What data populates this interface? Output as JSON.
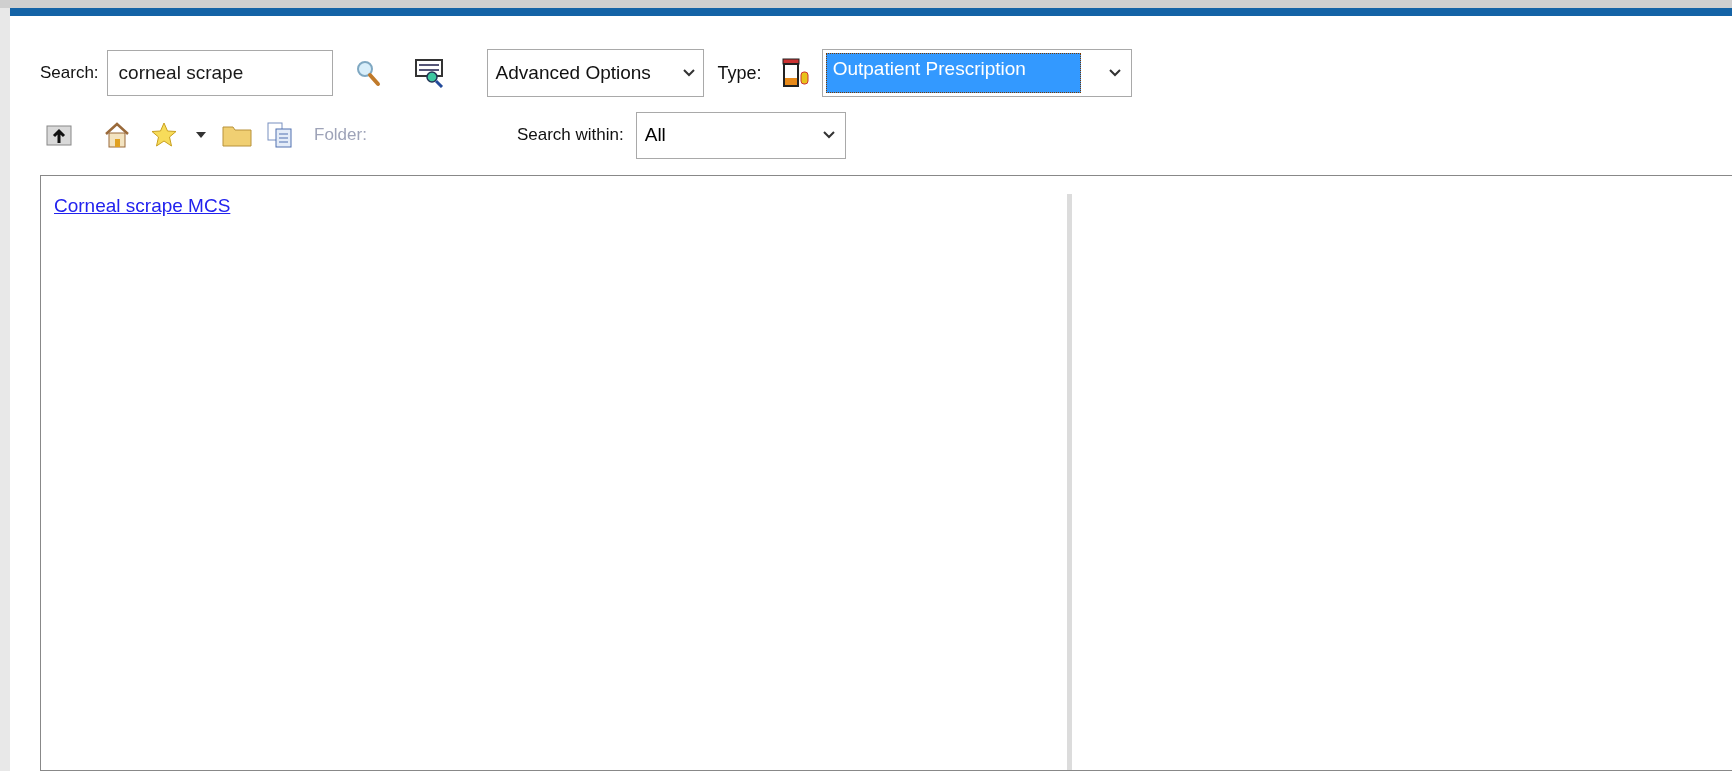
{
  "search": {
    "label": "Search:",
    "value": "corneal scrape"
  },
  "advanced_options": {
    "value": "Advanced Options"
  },
  "type": {
    "label": "Type:",
    "value": "Outpatient Prescription",
    "selected": true
  },
  "toolbar": {
    "folder_label": "Folder:",
    "folder_disabled": true
  },
  "search_within": {
    "label": "Search within:",
    "value": "All"
  },
  "results": [
    {
      "label": "Corneal scrape MCS"
    }
  ]
}
